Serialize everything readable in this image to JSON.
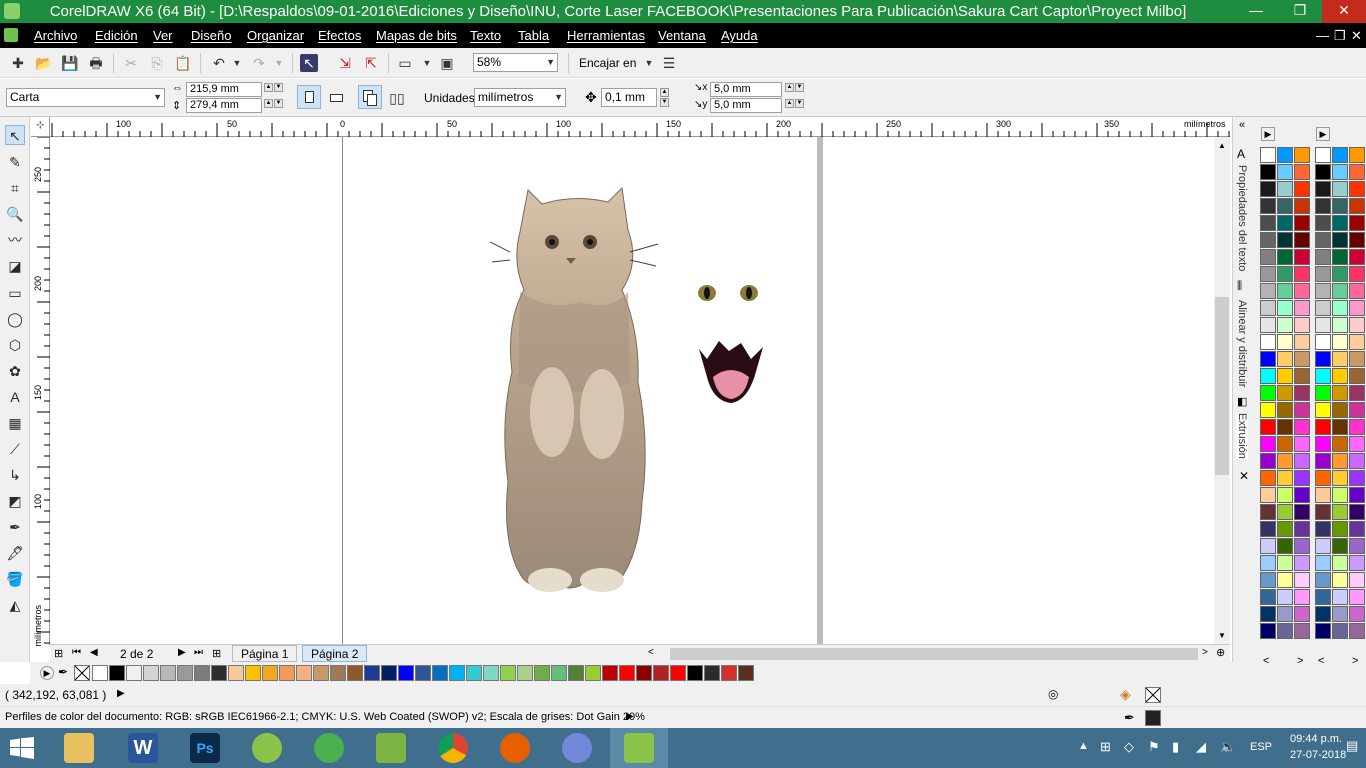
{
  "window": {
    "title": "CorelDRAW X6 (64 Bit) - [D:\\Respaldos\\09-01-2016\\Ediciones y Diseño\\INU, Corte Laser FACEBOOK\\Presentaciones Para Publicación\\Sakura Cart Captor\\Proyect Milbo]",
    "minimize": "—",
    "restore": "❐",
    "close": "✕",
    "doc_min": "—",
    "doc_restore": "❐",
    "doc_close": "✕"
  },
  "menu": [
    "Archivo",
    "Edición",
    "Ver",
    "Diseño",
    "Organizar",
    "Efectos",
    "Mapas de bits",
    "Texto",
    "Tabla",
    "Herramientas",
    "Ventana",
    "Ayuda"
  ],
  "toolbar": {
    "zoom": "58%",
    "snap": "Encajar en"
  },
  "property_bar": {
    "page_preset": "Carta",
    "width": "215,9 mm",
    "height": "279,4 mm",
    "units_label": "Unidades:",
    "units_value": "milímetros",
    "nudge": "0,1 mm",
    "dup_x": "5,0 mm",
    "dup_y": "5,0 mm"
  },
  "rulers": {
    "h_labels": [
      "100",
      "50",
      "0",
      "50",
      "100",
      "150",
      "200",
      "250",
      "300",
      "350"
    ],
    "h_unit": "milímetros",
    "v_labels": [
      "250",
      "200",
      "150",
      "100",
      "50"
    ],
    "v_unit": "milímetros"
  },
  "pages": {
    "counter": "2 de 2",
    "tabs": [
      "Página 1",
      "Página 2"
    ]
  },
  "dockers": [
    "Propiedades del texto",
    "Alinear y distribuir",
    "Extrusión"
  ],
  "palette": {
    "colors": [
      "#ffffff",
      "#000000",
      "#f0f0f0",
      "#d4d4d4",
      "#b8b8b8",
      "#9a9a9a",
      "#7c7c7c",
      "#2e2e2e",
      "#f8c89a",
      "#ffc000",
      "#f5a623",
      "#f29a5c",
      "#f4b183",
      "#c49a6c",
      "#a0785a",
      "#8b5a2b",
      "#1f3a93",
      "#002060",
      "#0000ff",
      "#2f5597",
      "#0070c0",
      "#00b0f0",
      "#33cccc",
      "#7fd8c4",
      "#92d050",
      "#a9d18e",
      "#70ad47",
      "#63be7b",
      "#548235",
      "#9acd32",
      "#c00000",
      "#ff0000",
      "#8b0000",
      "#b22222",
      "#ff0000",
      "#000000",
      "#2b2b2b",
      "#d32f2f",
      "#5c2e1f"
    ]
  },
  "status": {
    "coords": "( 342,192, 63,081 )",
    "profile": "Perfiles de color del documento: RGB: sRGB IEC61966-2.1; CMYK: U.S. Web Coated (SWOP) v2; Escala de grises: Dot Gain 20%"
  },
  "taskbar": {
    "time": "09:44 p.m.",
    "date": "27-07-2018",
    "lang": "ESP"
  },
  "color_palette_1": [
    "#ffffff",
    "#000000",
    "#1a1a1a",
    "#333333",
    "#4d4d4d",
    "#666666",
    "#808080",
    "#999999",
    "#b3b3b3",
    "#cccccc",
    "#e6e6e6",
    "#ffffff",
    "#0000ff",
    "#00ffff",
    "#00ff00",
    "#ffff00",
    "#ff0000",
    "#ff00ff",
    "#9900cc",
    "#ff6600",
    "#ffcc99",
    "#663333",
    "#333366",
    "#ccccff",
    "#99ccff",
    "#6699cc",
    "#336699",
    "#003366",
    "#000066"
  ],
  "color_palette_2": [
    "#0099ff",
    "#66ccff",
    "#99cccc",
    "#336666",
    "#006666",
    "#003333",
    "#006633",
    "#339966",
    "#66cc99",
    "#99ffcc",
    "#ccffcc",
    "#ffffcc",
    "#ffcc66",
    "#ffcc00",
    "#cc9900",
    "#996600",
    "#663300",
    "#cc6600",
    "#ff9933",
    "#ffcc33",
    "#ccff66",
    "#99cc33",
    "#669900",
    "#336600",
    "#ccff99",
    "#ffff99",
    "#ccccff",
    "#9999cc",
    "#666699"
  ],
  "color_palette_3": [
    "#ff9900",
    "#ff6633",
    "#ff3300",
    "#cc3300",
    "#990000",
    "#660000",
    "#cc0033",
    "#ff3366",
    "#ff6699",
    "#ff99cc",
    "#ffcccc",
    "#ffcc99",
    "#cc9966",
    "#996633",
    "#993366",
    "#cc3399",
    "#ff33cc",
    "#ff66ff",
    "#cc66ff",
    "#9933ff",
    "#6600cc",
    "#330066",
    "#663399",
    "#9966cc",
    "#cc99ff",
    "#ffccff",
    "#ff99ff",
    "#cc66cc",
    "#996699"
  ]
}
